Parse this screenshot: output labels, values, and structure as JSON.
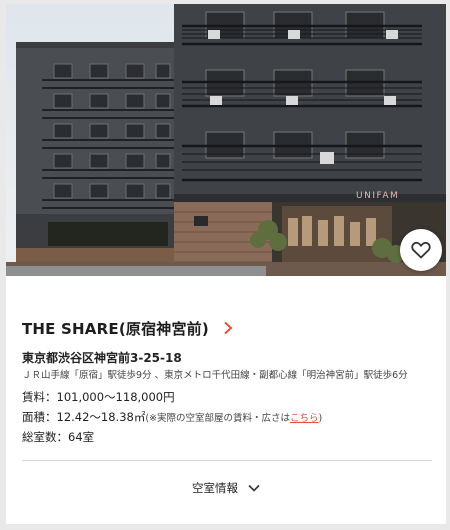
{
  "listing": {
    "title": "THE SHARE(原宿神宮前)",
    "address": "東京都渋谷区神宮前3-25-18",
    "access": "ＪＲ山手線「原宿」駅徒歩9分 、東京メトロ千代田線・副都心線「明治神宮前」駅徒歩6分",
    "rent": "賃料：101,000〜118,000円",
    "area_label": "面積：12.42〜18.38㎡",
    "area_note_prefix": "(※実際の空室部屋の賃料・広さは",
    "area_note_link": "こちら",
    "area_note_suffix": ")",
    "rooms": "総室数：64室",
    "vacancy_label": "空室情報",
    "shop_sign": "UNIFAM"
  },
  "icons": {
    "favorite": "heart-outline-icon",
    "title_arrow": "chevron-right-icon",
    "vacancy_toggle": "chevron-down-icon"
  },
  "colors": {
    "accent": "#e0503d",
    "card_background": "#ffffff",
    "page_background": "#e9e9e9"
  }
}
